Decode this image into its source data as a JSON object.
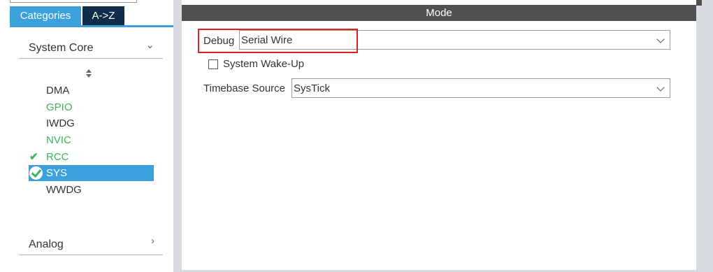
{
  "tabs": {
    "categories": "Categories",
    "az": "A->Z"
  },
  "sections": {
    "system_core": {
      "label": "System Core",
      "expanded": true,
      "chevron": "chevron-down-icon"
    },
    "analog": {
      "label": "Analog",
      "expanded": false,
      "chevron": "chevron-right-icon"
    }
  },
  "peripherals": [
    {
      "name": "DMA",
      "state": "normal"
    },
    {
      "name": "GPIO",
      "state": "green"
    },
    {
      "name": "IWDG",
      "state": "normal"
    },
    {
      "name": "NVIC",
      "state": "green"
    },
    {
      "name": "RCC",
      "state": "green-checked"
    },
    {
      "name": "SYS",
      "state": "selected-checked"
    },
    {
      "name": "WWDG",
      "state": "normal"
    }
  ],
  "mode": {
    "title": "Mode",
    "debug": {
      "label": "Debug",
      "value": "Serial Wire"
    },
    "wakeup": {
      "label": "System Wake-Up",
      "checked": false
    },
    "timebase": {
      "label": "Timebase Source",
      "value": "SysTick"
    }
  },
  "colors": {
    "accent_blue": "#3ca0dc",
    "dark_tab": "#0f2d4a",
    "ok_green": "#3cb45a",
    "header_gray": "#505050",
    "highlight_red": "#e02020"
  }
}
